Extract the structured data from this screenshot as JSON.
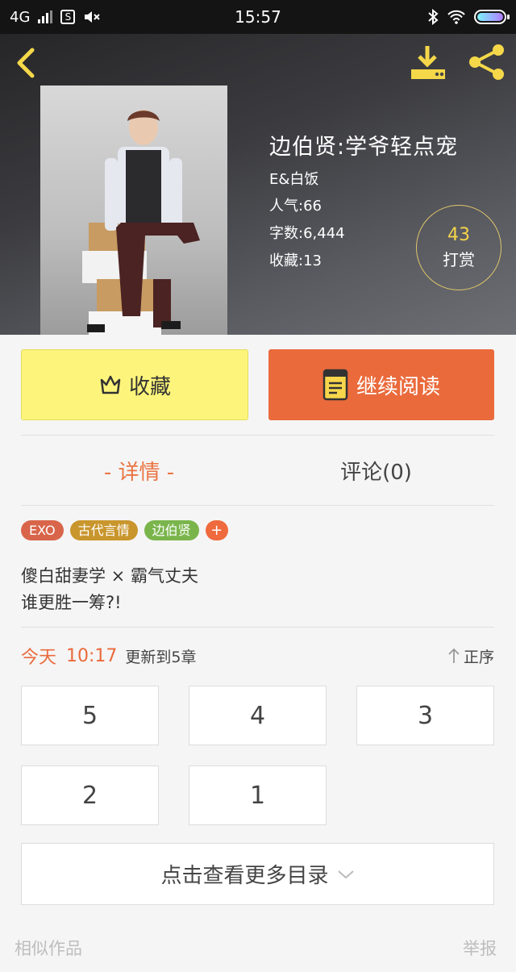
{
  "status_bar": {
    "network": "4G",
    "time": "15:57",
    "colors": {
      "battery_start": "#7cf3ff",
      "battery_end": "#b07cff"
    }
  },
  "header": {
    "title": "边伯贤:学爷轻点宠",
    "author": "E&白饭",
    "popularity": "人气:66",
    "word_count": "字数:6,444",
    "favorites": "收藏:13",
    "tip": {
      "count": "43",
      "label": "打赏"
    }
  },
  "actions": {
    "collect_label": "收藏",
    "read_label": "继续阅读",
    "colors": {
      "collect_bg": "#fdf57b",
      "read_bg": "#ea6a3c"
    }
  },
  "tabs": [
    {
      "label": "- 详情 -",
      "active": true
    },
    {
      "label": "评论(0)",
      "active": false
    }
  ],
  "tags": [
    {
      "label": "EXO",
      "color": "#d8654a"
    },
    {
      "label": "古代言情",
      "color": "#c9962d"
    },
    {
      "label": "边伯贤",
      "color": "#7ab54c"
    },
    {
      "label": "+",
      "color": "#ef6a3c"
    }
  ],
  "summary": [
    "傻白甜妻学 × 霸气丈夫",
    "谁更胜一筹?!"
  ],
  "update": {
    "day": "今天",
    "time": "10:17",
    "text": "更新到5章",
    "sort_label": "正序"
  },
  "chapters": [
    "5",
    "4",
    "3",
    "2",
    "1"
  ],
  "more_button": {
    "label": "点击查看更多目录"
  },
  "footer": {
    "left": "相似作品",
    "right": "举报"
  }
}
